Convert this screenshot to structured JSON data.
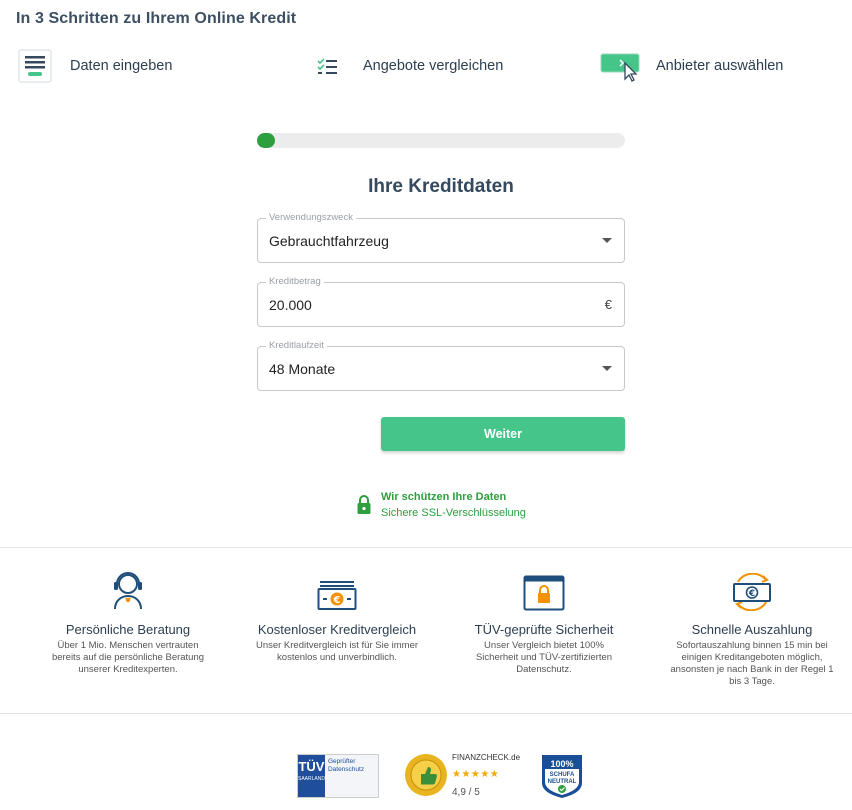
{
  "page": {
    "title": "In 3 Schritten zu Ihrem Online Kredit"
  },
  "steps": [
    {
      "label": "Daten eingeben",
      "icon": "form-lines-icon"
    },
    {
      "label": "Angebote vergleichen",
      "icon": "checklist-icon"
    },
    {
      "label": "Anbieter auswählen",
      "icon": "cursor-click-icon"
    }
  ],
  "progress": {
    "percent": 5,
    "color": "#2e9e3f"
  },
  "form": {
    "title": "Ihre Kreditdaten",
    "purpose": {
      "label": "Verwendungszweck",
      "value": "Gebrauchtfahrzeug"
    },
    "amount": {
      "label": "Kreditbetrag",
      "value": "20.000",
      "suffix": "€"
    },
    "term": {
      "label": "Kreditlaufzeit",
      "value": "48 Monate"
    },
    "submit_label": "Weiter",
    "accent_color": "#45c58a"
  },
  "security": {
    "line1": "Wir schützen Ihre Daten",
    "line2": "Sichere SSL-Verschlüsselung",
    "icon": "lock-icon"
  },
  "features": [
    {
      "icon": "headset-agent-icon",
      "title": "Persönliche Beratung",
      "desc": "Über 1 Mio. Menschen vertrauten bereits auf die persönliche Beratung unserer Kreditexperten."
    },
    {
      "icon": "euro-banknote-icon",
      "title": "Kostenloser Kreditvergleich",
      "desc": "Unser Kreditvergleich ist für Sie immer kostenlos und unverbindlich."
    },
    {
      "icon": "secure-window-icon",
      "title": "TÜV-geprüfte Sicherheit",
      "desc": "Unser Vergleich bietet 100% Sicherheit und TÜV-zertifizierten Datenschutz."
    },
    {
      "icon": "euro-exchange-icon",
      "title": "Schnelle Auszahlung",
      "desc": "Sofortauszahlung binnen 15 min bei einigen Kreditangeboten möglich, ansonsten je nach Bank in der Regel 1 bis 3 Tage."
    }
  ],
  "seals": {
    "tuv": {
      "brand": "TÜV",
      "region": "SAARLAND",
      "text": "Geprüfter Datenschutz"
    },
    "finanzcheck": {
      "name": "FINANZCHECK.de",
      "stars": "★★★★★",
      "rating": "4,9 / 5"
    },
    "schufa": {
      "line1": "100%",
      "line2": "SCHUFA",
      "line3": "NEUTRAL"
    }
  }
}
